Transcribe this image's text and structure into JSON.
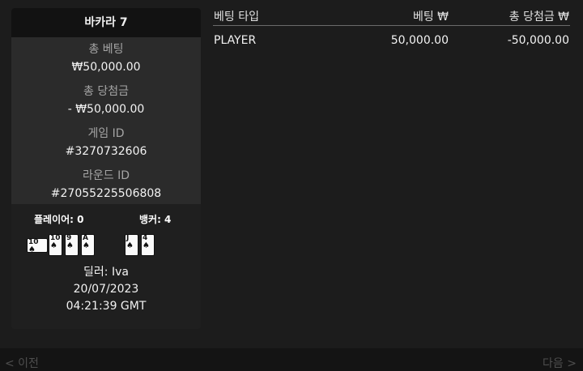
{
  "panel": {
    "title": "바카라 7",
    "total_bet_label": "총 베팅",
    "total_bet_value": "₩50,000.00",
    "total_win_label": "총 당첨금",
    "total_win_value": "- ₩50,000.00",
    "game_id_label": "게임 ID",
    "game_id_value": "#3270732606",
    "round_id_label": "라운드 ID",
    "round_id_value": "#27055225506808"
  },
  "result": {
    "player_score": "플레이어: 0",
    "banker_score": "뱅커: 4",
    "player_cards": [
      {
        "rank": "10",
        "suit": "♠",
        "rotated": true
      },
      {
        "rank": "10",
        "suit": "♠",
        "rotated": false
      },
      {
        "rank": "9",
        "suit": "♠",
        "rotated": false
      },
      {
        "rank": "A",
        "suit": "♠",
        "rotated": false
      }
    ],
    "banker_cards": [
      {
        "rank": "J",
        "suit": "♠",
        "rotated": false
      },
      {
        "rank": "4",
        "suit": "♠",
        "rotated": false
      }
    ],
    "dealer": "딜러: Iva",
    "date": "20/07/2023",
    "time": "04:21:39 GMT"
  },
  "table": {
    "headers": [
      "베팅 타입",
      "베팅 ₩",
      "총 당첨금 ₩"
    ],
    "rows": [
      {
        "type": "PLAYER",
        "bet": "50,000.00",
        "win": "-50,000.00"
      }
    ]
  },
  "footer": {
    "prev": "< 이전",
    "next": "다음 >"
  },
  "colors": {
    "background": "#1c1c1c",
    "panel": "#2b2b2b",
    "header": "#121212",
    "muted_text": "#a4a4a4",
    "footer_text": "#4e4e4e"
  }
}
